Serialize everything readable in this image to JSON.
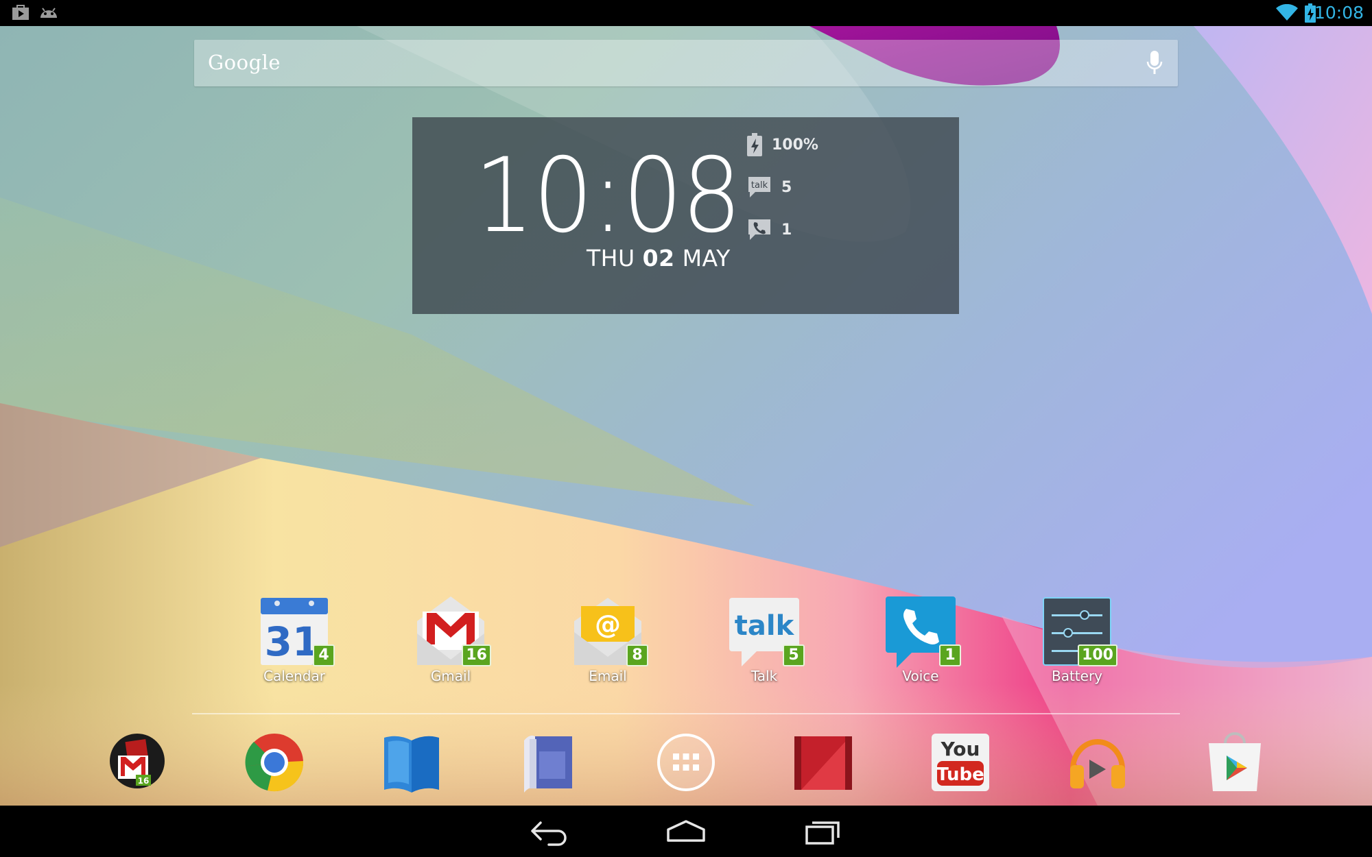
{
  "status_bar": {
    "time": "10:08",
    "left_icons": [
      "play-store-notification-icon",
      "android-notification-icon"
    ],
    "right_icons": [
      "wifi-icon",
      "battery-charging-icon"
    ],
    "accent": "#33b5e5"
  },
  "search": {
    "logo": "Google",
    "icon": "mic-icon"
  },
  "clock_widget": {
    "time": "10:08",
    "day": "THU",
    "date": "02",
    "month": "MAY",
    "stats": [
      {
        "icon": "battery-charging-icon",
        "value": "100%"
      },
      {
        "icon": "talk-icon",
        "value": "5",
        "icon_text": "talk"
      },
      {
        "icon": "phone-icon",
        "value": "1"
      }
    ]
  },
  "apps": [
    {
      "label": "Calendar",
      "badge": "4",
      "icon": "calendar-icon",
      "icon_text": "31"
    },
    {
      "label": "Gmail",
      "badge": "16",
      "icon": "gmail-icon"
    },
    {
      "label": "Email",
      "badge": "8",
      "icon": "email-icon",
      "icon_text": "@"
    },
    {
      "label": "Talk",
      "badge": "5",
      "icon": "talk-icon",
      "icon_text": "talk"
    },
    {
      "label": "Voice",
      "badge": "1",
      "icon": "voice-icon"
    },
    {
      "label": "Battery",
      "badge": "100",
      "icon": "battery-settings-icon"
    }
  ],
  "dock": {
    "gmail_badge": "16",
    "youtube_top": "You",
    "youtube_bottom": "Tube",
    "items": [
      "gmail-widget-icon",
      "chrome-icon",
      "play-books-icon",
      "magazines-icon",
      "app-drawer-icon",
      "play-movies-icon",
      "youtube-icon",
      "play-music-icon",
      "play-store-icon"
    ]
  },
  "nav_bar": [
    "back-icon",
    "home-icon",
    "recents-icon"
  ],
  "colors": {
    "badge_green": "#5aa51f",
    "widget_bg": "#3a424a"
  }
}
